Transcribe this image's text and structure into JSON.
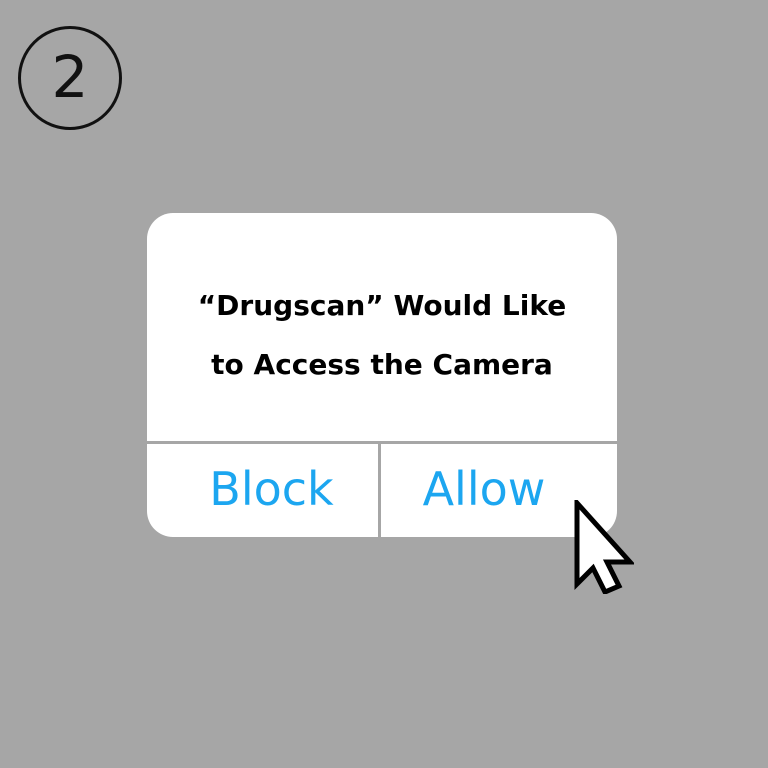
{
  "step": {
    "number": "2"
  },
  "dialog": {
    "title_line_1": "“Drugscan” Would Like",
    "title_line_2": "to Access the Camera",
    "block_label": "Block",
    "allow_label": "Allow"
  },
  "colors": {
    "background": "#a6a6a6",
    "dialog_background": "#ffffff",
    "button_text": "#1ca6f0",
    "title_text": "#000000"
  },
  "icons": {
    "cursor": "arrow-cursor-icon",
    "step": "step-number-badge"
  }
}
